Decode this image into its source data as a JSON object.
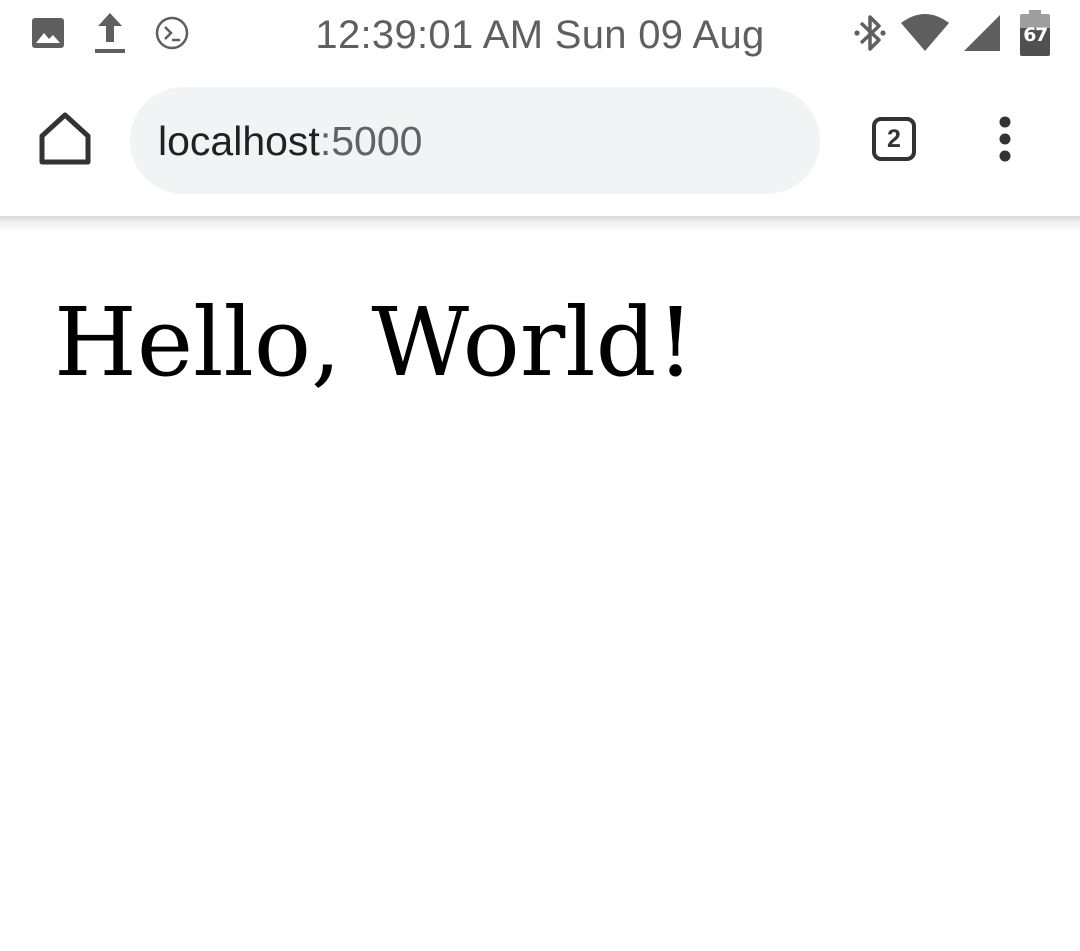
{
  "status_bar": {
    "time": "12:39:01 AM Sun 09 Aug",
    "left_icons": [
      "image-icon",
      "upload-icon",
      "terminal-icon"
    ],
    "right_icons": [
      "bluetooth-icon",
      "wifi-icon",
      "cellular-signal-icon",
      "battery-icon"
    ],
    "battery_level": "67",
    "battery_fraction": 0.67
  },
  "browser": {
    "url_host": "localhost",
    "url_port": ":5000",
    "tab_count": "2",
    "icons": [
      "home-icon",
      "tab-switcher-icon",
      "more-vert-icon"
    ]
  },
  "page": {
    "heading": "Hello, World!"
  },
  "colors": {
    "status_icon": "#5f5f5f",
    "address_bar_bg": "#f1f3f4",
    "url_port_text": "#5f6368",
    "page_text": "#000000"
  }
}
